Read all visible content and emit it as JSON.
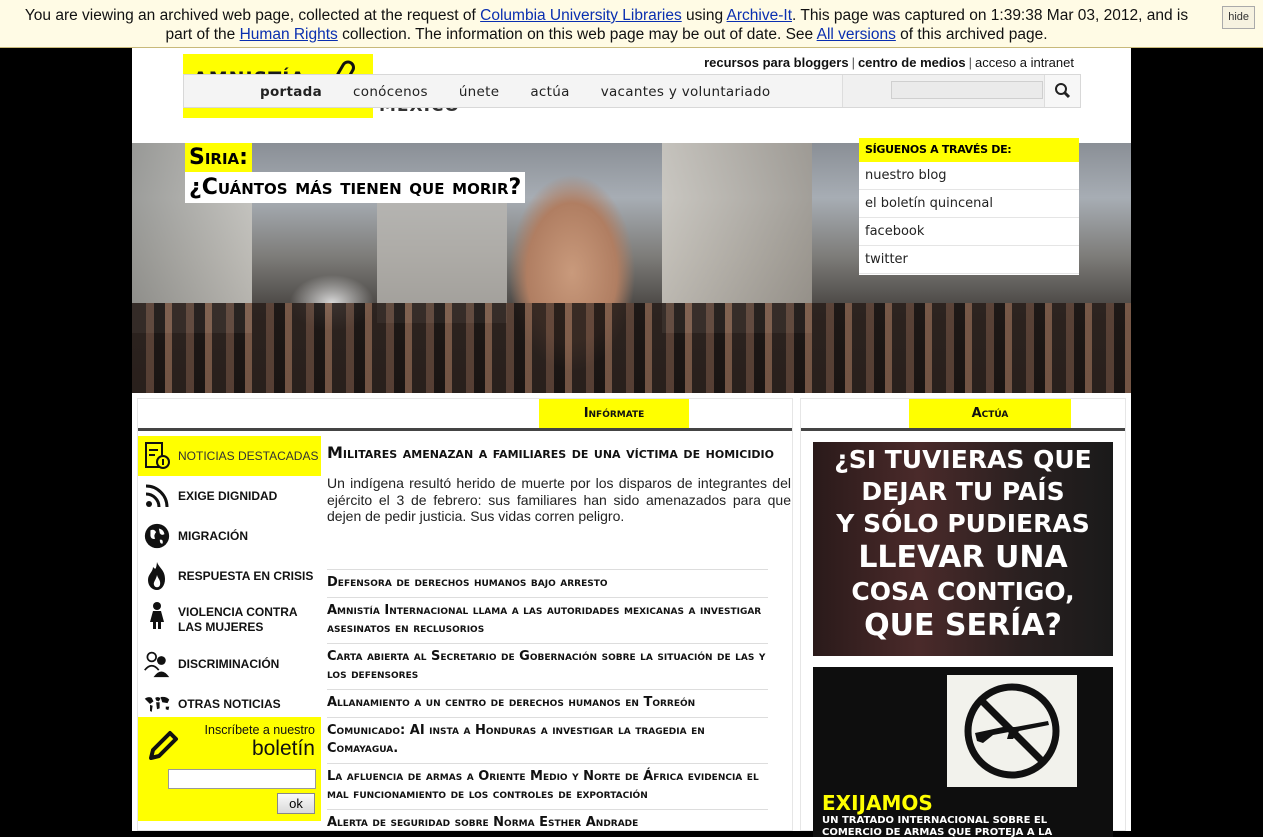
{
  "archive": {
    "t1": "You are viewing an archived web page, collected at the request of ",
    "l1": "Columbia University Libraries",
    "t2": " using ",
    "l2": "Archive-It",
    "t3": ". This page was captured on 1:39:38 Mar 03, 2012, and is part of the ",
    "l3": "Human Rights",
    "t4": " collection. The information on this web page may be out of date. See ",
    "l4": "All versions",
    "t5": " of this archived page.",
    "hide": "hide"
  },
  "header": {
    "logo_text": "AMNISTÍA",
    "logo_sub": "MÉXICO",
    "top_links": [
      "recursos para bloggers",
      "centro de medios",
      "acceso a intranet"
    ],
    "nav": [
      "portada",
      "conócenos",
      "únete",
      "actúa",
      "vacantes y voluntariado"
    ]
  },
  "hero": {
    "headline_1": "Siria:",
    "headline_2": "¿Cuántos más tienen que morir?",
    "follow_title": "SÍGUENOS A TRAVÉS DE:",
    "follow_links": [
      "nuestro blog",
      "el boletín quincenal",
      "facebook",
      "twitter"
    ]
  },
  "informate": {
    "tab": "Infórmate",
    "categories": [
      {
        "label": "NOTICIAS DESTACADAS",
        "icon": "news-document-icon"
      },
      {
        "label": "EXIGE DIGNIDAD",
        "icon": "rss-icon"
      },
      {
        "label": "MIGRACIÓN",
        "icon": "globe-icon"
      },
      {
        "label": "RESPUESTA EN CRISIS",
        "icon": "fire-icon"
      },
      {
        "label": "VIOLENCIA CONTRA LAS MUJERES",
        "icon": "woman-icon"
      },
      {
        "label": "DISCRIMINACIÓN",
        "icon": "people-icon"
      },
      {
        "label": "OTRAS NOTICIAS",
        "icon": "world-map-icon"
      }
    ],
    "newsletter": {
      "line1": "Inscríbete a nuestro",
      "line2": "boletín",
      "ok": "ok"
    },
    "main_title": "Militares amenazan a familiares de una víctima de homicidio",
    "main_summary": "Un indígena resultó herido de muerte por los disparos de integrantes del ejército el 3 de febrero: sus familiares han sido amenazados para que dejen de pedir justicia. Sus vidas corren peligro.",
    "headlines": [
      "Defensora de derechos humanos bajo arresto",
      "Amnistía Internacional llama a las autoridades mexicanas a investigar asesinatos en reclusorios",
      "Carta abierta al Secretario de Gobernación sobre la situación de las y los defensores",
      "Allanamiento a un centro de derechos humanos en Torreón",
      "Comunicado: AI insta a Honduras a investigar la tragedia en Comayagua.",
      "La afluencia de armas a Oriente Medio y Norte de África evidencia el mal funcionamiento de los controles de exportación",
      "Alerta de seguridad sobre Norma Esther Andrade"
    ]
  },
  "actua": {
    "tab": "Actúa",
    "banner1_lines": [
      "¿SI TUVIERAS QUE",
      "DEJAR TU PAÍS",
      "Y SÓLO PUDIERAS",
      "LLEVAR UNA",
      "COSA CONTIGO,",
      "QUE SERÍA?"
    ],
    "banner2_title": "EXIJAMOS",
    "banner2_text": "UN TRATADO INTERNACIONAL SOBRE EL COMERCIO DE ARMAS QUE PROTEJA A LA GENTE"
  },
  "colors": {
    "accent": "#ffff00",
    "link": "#0a2fb0"
  }
}
